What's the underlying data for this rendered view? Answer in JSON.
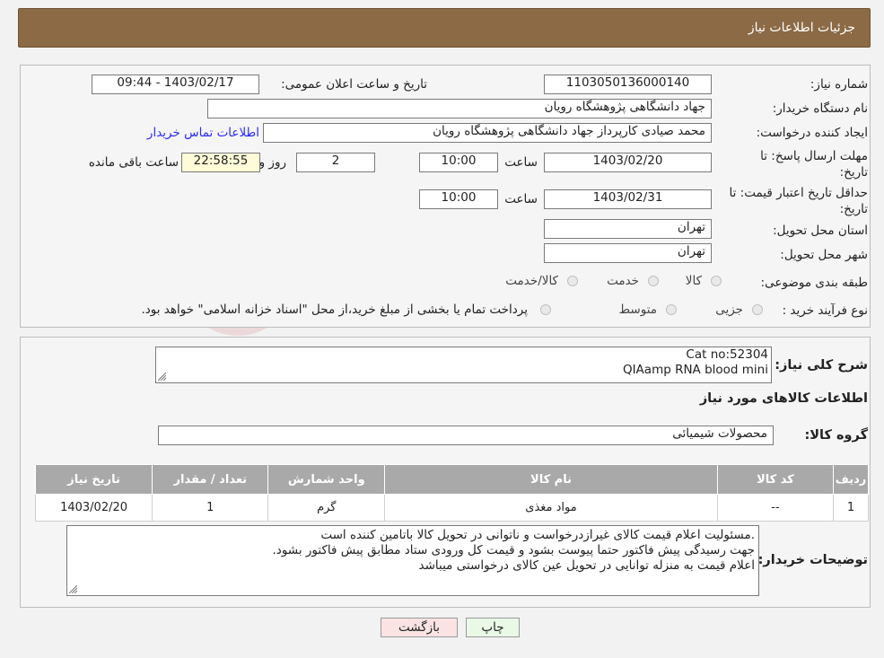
{
  "header": {
    "title": "جزئیات اطلاعات نیاز"
  },
  "form": {
    "need_number_label": "شماره نیاز:",
    "need_number": "1103050136000140",
    "announce_label": "تاریخ و ساعت اعلان عمومی:",
    "announce_value": "1403/02/17 - 09:44",
    "buyer_org_label": "نام دستگاه خریدار:",
    "buyer_org": "جهاد دانشگاهی پژوهشگاه رویان",
    "creator_label": "ایجاد کننده درخواست:",
    "creator": "محمد صیادی کارپرداز جهاد دانشگاهی پژوهشگاه رویان",
    "contact_link": "اطلاعات تماس خریدار",
    "deadline_label_1": "مهلت ارسال پاسخ: تا",
    "deadline_label_2": "تاریخ:",
    "deadline_date": "1403/02/20",
    "time_label": "ساعت",
    "deadline_time": "10:00",
    "days": "2",
    "days_label": "روز و",
    "remaining": "22:58:55",
    "remaining_label": "ساعت باقی مانده",
    "validity_label_1": "حداقل تاریخ اعتبار قیمت: تا",
    "validity_label_2": "تاریخ:",
    "validity_date": "1403/02/31",
    "validity_time": "10:00",
    "province_label": "استان محل تحویل:",
    "province": "تهران",
    "city_label": "شهر محل تحویل:",
    "city": "تهران",
    "category_label": "طبقه بندی موضوعی:",
    "category_options": [
      "کالا",
      "خدمت",
      "کالا/خدمت"
    ],
    "process_label": "نوع فرآیند خرید :",
    "process_options": [
      "جزیی",
      "متوسط"
    ],
    "process_note": "پرداخت تمام یا بخشی از مبلغ خرید،از محل \"اسناد خزانه اسلامی\" خواهد بود."
  },
  "details": {
    "summary_label": "شرح کلی نیاز:",
    "summary_line1": "Cat no:52304",
    "summary_line2": "QIAamp RNA blood mini",
    "goods_info_title": "اطلاعات کالاهای مورد نیاز",
    "goods_group_label": "گروه کالا:",
    "goods_group": "محصولات شیمیائی",
    "table": {
      "headers": [
        "ردیف",
        "کد کالا",
        "نام کالا",
        "واحد شمارش",
        "تعداد / مقدار",
        "تاریخ نیاز"
      ],
      "rows": [
        [
          "1",
          "--",
          "مواد مغذی",
          "گرم",
          "1",
          "1403/02/20"
        ]
      ]
    },
    "buyer_notes_label": "توضیحات خریدار:",
    "buyer_notes": [
      ".مسئولیت اعلام قیمت کالای غیرازدرخواست و ناتوانی در تحویل کالا باتامین کننده است",
      "جهت رسیدگی پیش فاکتور حتما پیوست بشود و قیمت کل ورودی ستاد مطابق پیش فاکتور بشود.",
      "اعلام قیمت به منزله توانایی در تحویل عین کالای درخواستی میباشد"
    ]
  },
  "buttons": {
    "print": "چاپ",
    "back": "بازگشت"
  },
  "colors": {
    "header": "#8b6a45",
    "table_header": "#a9a9a9",
    "back_button": "#fbe3e3",
    "print_button": "#eaf8e6"
  }
}
